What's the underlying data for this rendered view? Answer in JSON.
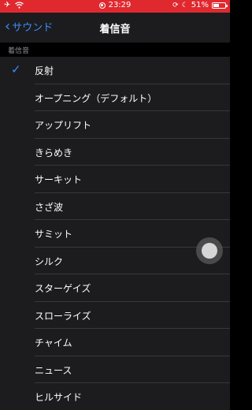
{
  "status": {
    "time": "23:29",
    "battery": "51%",
    "battery_level": 0.51
  },
  "nav": {
    "back_label": "サウンド",
    "title": "着信音"
  },
  "section": {
    "header": "着信音"
  },
  "items": [
    {
      "label": "反射",
      "checked": true
    },
    {
      "label": "オープニング（デフォルト）"
    },
    {
      "label": "アップリフト"
    },
    {
      "label": "きらめき"
    },
    {
      "label": "サーキット"
    },
    {
      "label": "さざ波"
    },
    {
      "label": "サミット"
    },
    {
      "label": "シルク"
    },
    {
      "label": "スターゲイズ"
    },
    {
      "label": "スローライズ"
    },
    {
      "label": "チャイム"
    },
    {
      "label": "ニュース"
    },
    {
      "label": "ヒルサイド"
    }
  ],
  "colors": {
    "status_bar": "#e0282f",
    "accent": "#3c8df6",
    "background": "#1c1c1e"
  },
  "icons": {
    "airplane": "airplane-icon",
    "wifi": "wifi-icon",
    "recording": "screen-recording-icon",
    "orientation_lock": "orientation-lock-icon",
    "moon": "do-not-disturb-icon",
    "check": "checkmark-icon",
    "back": "chevron-left-icon"
  }
}
